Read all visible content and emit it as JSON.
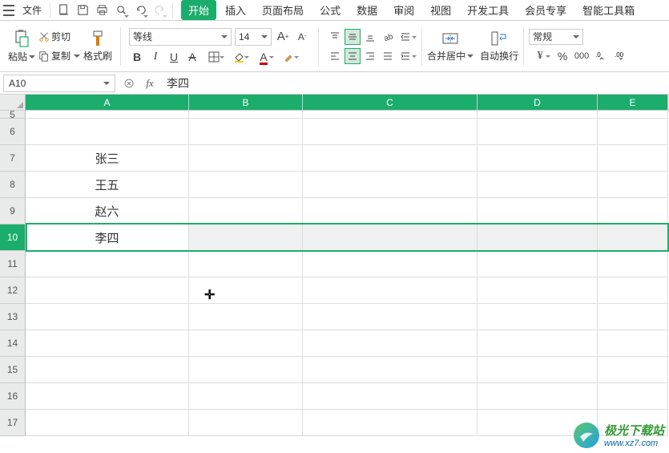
{
  "menu": {
    "file_label": "文件",
    "tabs": [
      "开始",
      "插入",
      "页面布局",
      "公式",
      "数据",
      "审阅",
      "视图",
      "开发工具",
      "会员专享",
      "智能工具箱"
    ],
    "active_tab_index": 0
  },
  "ribbon": {
    "paste_label": "粘贴",
    "cut_label": "剪切",
    "copy_label": "复制",
    "format_painter_label": "格式刷",
    "font_name": "等线",
    "font_size": "14",
    "merge_label": "合并居中",
    "wrap_label": "自动换行",
    "number_format": "常规"
  },
  "cell_ref": "A10",
  "formula_value": "李四",
  "columns": [
    "A",
    "B",
    "C",
    "D",
    "E"
  ],
  "rows": [
    {
      "num": "5",
      "short": true
    },
    {
      "num": "6"
    },
    {
      "num": "7",
      "A": "张三"
    },
    {
      "num": "8",
      "A": "王五"
    },
    {
      "num": "9",
      "A": "赵六"
    },
    {
      "num": "10",
      "A": "李四",
      "selected": true
    },
    {
      "num": "11"
    },
    {
      "num": "12"
    },
    {
      "num": "13"
    },
    {
      "num": "14"
    },
    {
      "num": "15"
    },
    {
      "num": "16"
    },
    {
      "num": "17"
    }
  ],
  "watermark": {
    "cn": "极光下载站",
    "en": "www.xz7.com"
  }
}
